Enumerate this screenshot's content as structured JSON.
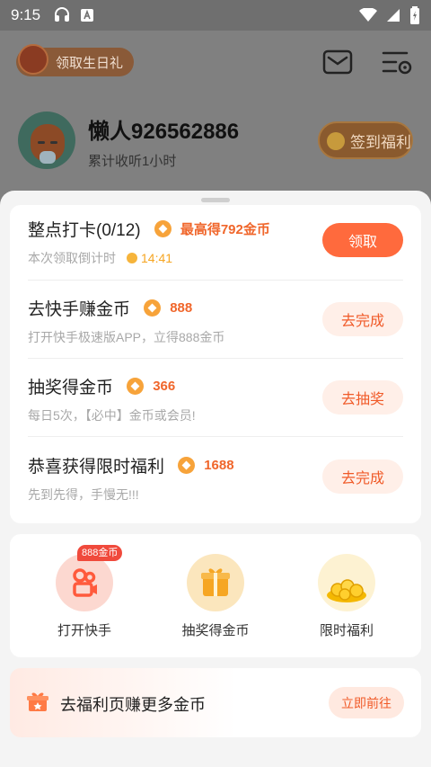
{
  "statusbar": {
    "time": "9:15"
  },
  "header": {
    "birthday_label": "领取生日礼",
    "username": "懒人926562886",
    "listen_time": "累计收听1小时",
    "checkin_label": "签到福利"
  },
  "tasks": [
    {
      "title": "整点打卡(0/12)",
      "reward": "最高得792金币",
      "sub": "本次领取倒计时",
      "timer": "14:41",
      "button": "领取"
    },
    {
      "title": "去快手赚金币",
      "reward": "888",
      "sub": "打开快手极速版APP，立得888金币",
      "button": "去完成"
    },
    {
      "title": "抽奖得金币",
      "reward": "366",
      "sub": "每日5次，【必中】金币或会员!",
      "button": "去抽奖"
    },
    {
      "title": "恭喜获得限时福利",
      "reward": "1688",
      "sub": "先到先得，手慢无!!!",
      "button": "去完成"
    }
  ],
  "shortcuts": {
    "badge": "888金币",
    "items": [
      {
        "label": "打开快手"
      },
      {
        "label": "抽奖得金币"
      },
      {
        "label": "限时福利"
      }
    ]
  },
  "banner": {
    "text": "去福利页赚更多金币",
    "button": "立即前往"
  },
  "colors": {
    "accent": "#ff6a3d",
    "coin": "#f7a33a",
    "reward_text": "#f0662b"
  }
}
